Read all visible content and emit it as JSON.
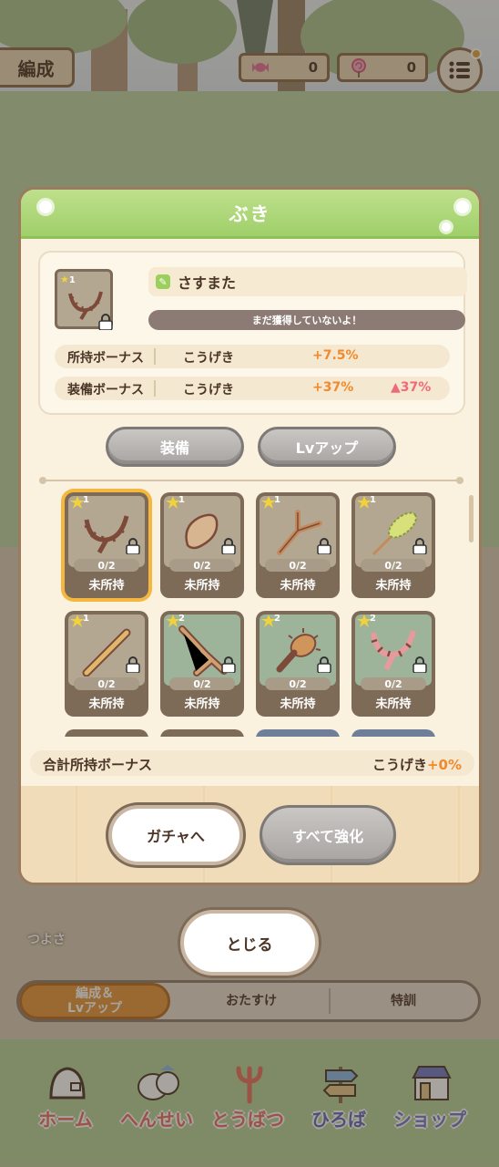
{
  "topbar": {
    "title": "編成",
    "candy_count": "0",
    "lollipop_count": "0",
    "candy_icon": "candy-icon",
    "lollipop_icon": "lollipop-icon",
    "menu_icon": "list-menu-icon"
  },
  "modal": {
    "title": "ぶき",
    "selected_item": {
      "name": "さすまた",
      "rarity": "1",
      "status_message": "まだ獲得していないよ！",
      "owned_bonus": {
        "label": "所持ボーナス",
        "stat": "こうげき",
        "value": "+7.5%"
      },
      "equip_bonus": {
        "label": "装備ボーナス",
        "stat": "こうげき",
        "value": "+37%",
        "increase": "▲37%"
      }
    },
    "buttons": {
      "equip": "装備",
      "levelup": "Lvアップ",
      "gacha": "ガチャへ",
      "enhance_all": "すべて強化"
    },
    "items": [
      {
        "rarity": "1",
        "count": "0/2",
        "status": "未所持",
        "icon": "sasumata-icon",
        "selected": true
      },
      {
        "rarity": "1",
        "count": "0/2",
        "status": "未所持",
        "icon": "seed-icon"
      },
      {
        "rarity": "1",
        "count": "0/2",
        "status": "未所持",
        "icon": "branch-icon"
      },
      {
        "rarity": "1",
        "count": "0/2",
        "status": "未所持",
        "icon": "foxtail-icon"
      },
      {
        "rarity": "1",
        "count": "0/2",
        "status": "未所持",
        "icon": "stick-icon"
      },
      {
        "rarity": "2",
        "count": "0/2",
        "status": "未所持",
        "icon": "crossed-sticks-icon"
      },
      {
        "rarity": "2",
        "count": "0/2",
        "status": "未所持",
        "icon": "spiked-club-icon"
      },
      {
        "rarity": "2",
        "count": "0/2",
        "status": "未所持",
        "icon": "pink-sasumata-icon"
      }
    ],
    "total_bonus": {
      "label": "合計所持ボーナス",
      "stat": "こうげき",
      "value": "+0%"
    }
  },
  "close_button": "とじる",
  "tsuyosa": "つよさ",
  "tabs": [
    {
      "label": "編成＆\nLvアップ",
      "active": true
    },
    {
      "label": "おたすけ",
      "locked": true
    },
    {
      "label": "特訓"
    }
  ],
  "nav": [
    {
      "label": "ホーム",
      "icon": "home-icon"
    },
    {
      "label": "へんせい",
      "icon": "characters-icon"
    },
    {
      "label": "とうばつ",
      "icon": "trident-icon"
    },
    {
      "label": "ひろば",
      "icon": "signpost-icon"
    },
    {
      "label": "ショップ",
      "icon": "shop-icon"
    }
  ],
  "colors": {
    "accent_orange": "#f08a2c",
    "header_green": "#9fcf6a",
    "increase_pink": "#ee6a7a",
    "selected_border": "#f5b73d"
  }
}
